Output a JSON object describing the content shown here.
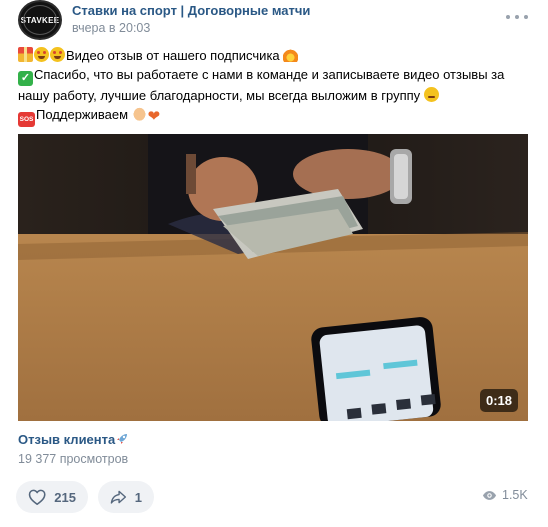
{
  "group": {
    "avatar_text": "STAVKEE",
    "name": "Ставки на спорт | Договорные матчи",
    "time": "вчера в 20:03"
  },
  "post": {
    "line1": "Видео отзыв от нашего подписчика",
    "line2": "Спасибо, что вы работаете с нами в команде и записываете видео отзывы за",
    "line3": "нашу работу, лучшие благодарности, мы всегда выложим в группу",
    "line4": "Поддерживаем",
    "sos_label": "SOS"
  },
  "video": {
    "duration": "0:18",
    "title": "Отзыв клиента",
    "views": "19 377 просмотров"
  },
  "actions": {
    "likes": "215",
    "shares": "1",
    "views": "1.5K"
  },
  "colors": {
    "link": "#2a5885",
    "meta": "#818c99",
    "action_bg": "#f0f2f5",
    "action_text": "#55677d"
  },
  "icons": [
    "more-dots-icon",
    "heart-icon",
    "share-arrow-icon",
    "eye-icon",
    "rocket-icon"
  ]
}
